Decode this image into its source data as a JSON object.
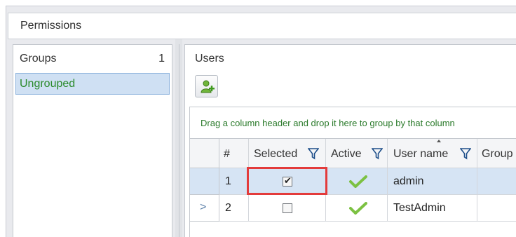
{
  "window": {
    "title": "Permissions"
  },
  "groups": {
    "header": "Groups",
    "count": "1",
    "items": [
      {
        "label": "Ungrouped"
      }
    ]
  },
  "users": {
    "header": "Users",
    "add_icon": "add-user-icon",
    "group_panel_hint": "Drag a column header and drop it here to group by that column",
    "columns": [
      "#",
      "Selected",
      "Active",
      "User name",
      "Group"
    ],
    "rows": [
      {
        "num": "1",
        "selected": true,
        "active": true,
        "user_name": "admin"
      },
      {
        "num": "2",
        "selected": false,
        "active": true,
        "user_name": "TestAdmin"
      }
    ],
    "current_row_indicator": ">"
  },
  "colors": {
    "selection": "#d6e4f4",
    "highlight_box": "#e33b3b",
    "green_text": "#2a8a2a"
  }
}
